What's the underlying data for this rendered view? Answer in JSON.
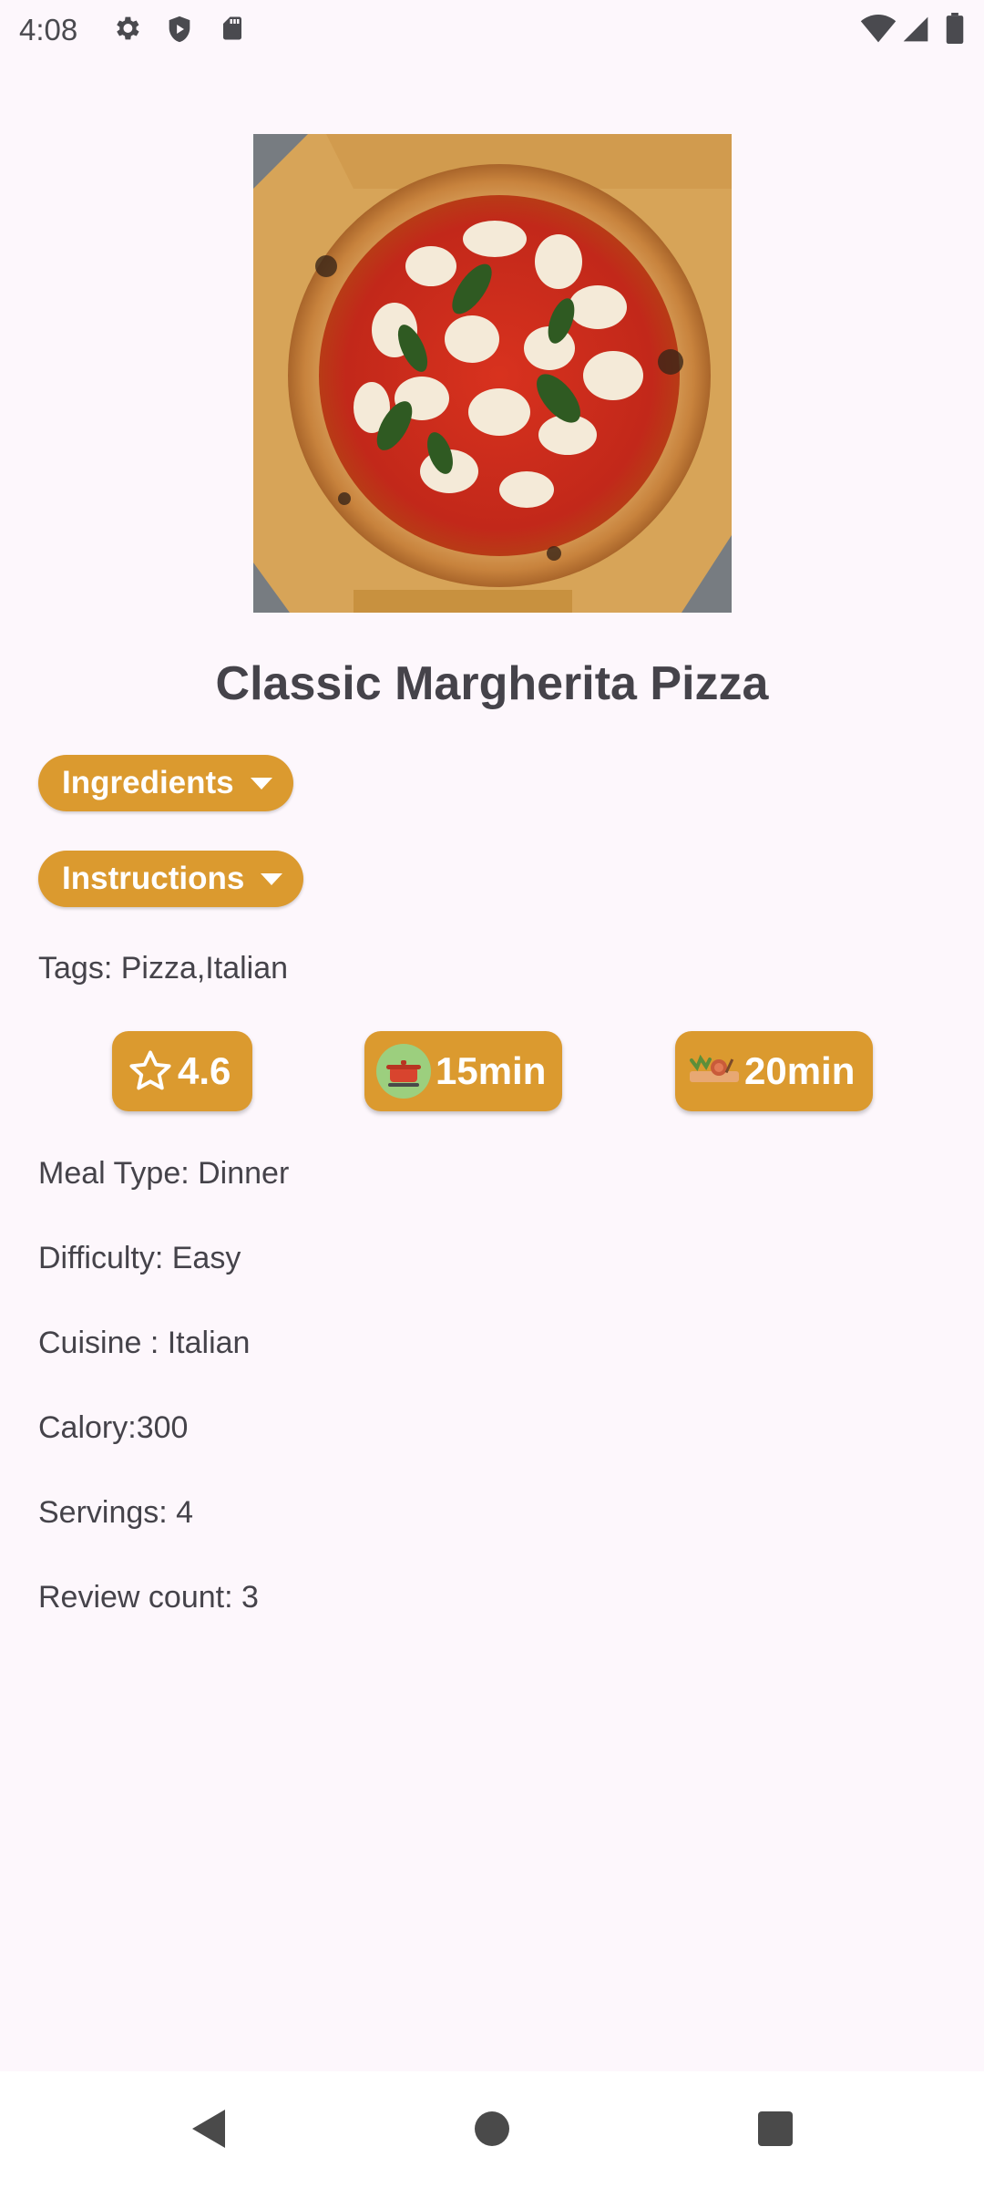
{
  "status_bar": {
    "time": "4:08",
    "icons": [
      "gear-icon",
      "shield-icon",
      "sd-card-icon",
      "wifi-icon",
      "signal-icon",
      "battery-icon"
    ]
  },
  "recipe": {
    "title": "Classic Margherita Pizza",
    "image_icon": "pizza-image",
    "ingredients_label": "Ingredients",
    "instructions_label": "Instructions",
    "tags": "Tags: Pizza,Italian",
    "rating": "4.6",
    "prep_time": "15min",
    "cook_time": "20min",
    "meal_type": "Meal Type: Dinner",
    "difficulty": "Difficulty: Easy",
    "cuisine": "Cuisine : Italian",
    "calory": "Calory:300",
    "servings": "Servings: 4",
    "review_count": "Review count: 3"
  },
  "colors": {
    "accent": "#db9a2f",
    "background": "#fdf7fc",
    "text": "#45434a"
  },
  "nav_bar": {
    "icons": [
      "back-icon",
      "home-icon",
      "recents-icon"
    ]
  }
}
